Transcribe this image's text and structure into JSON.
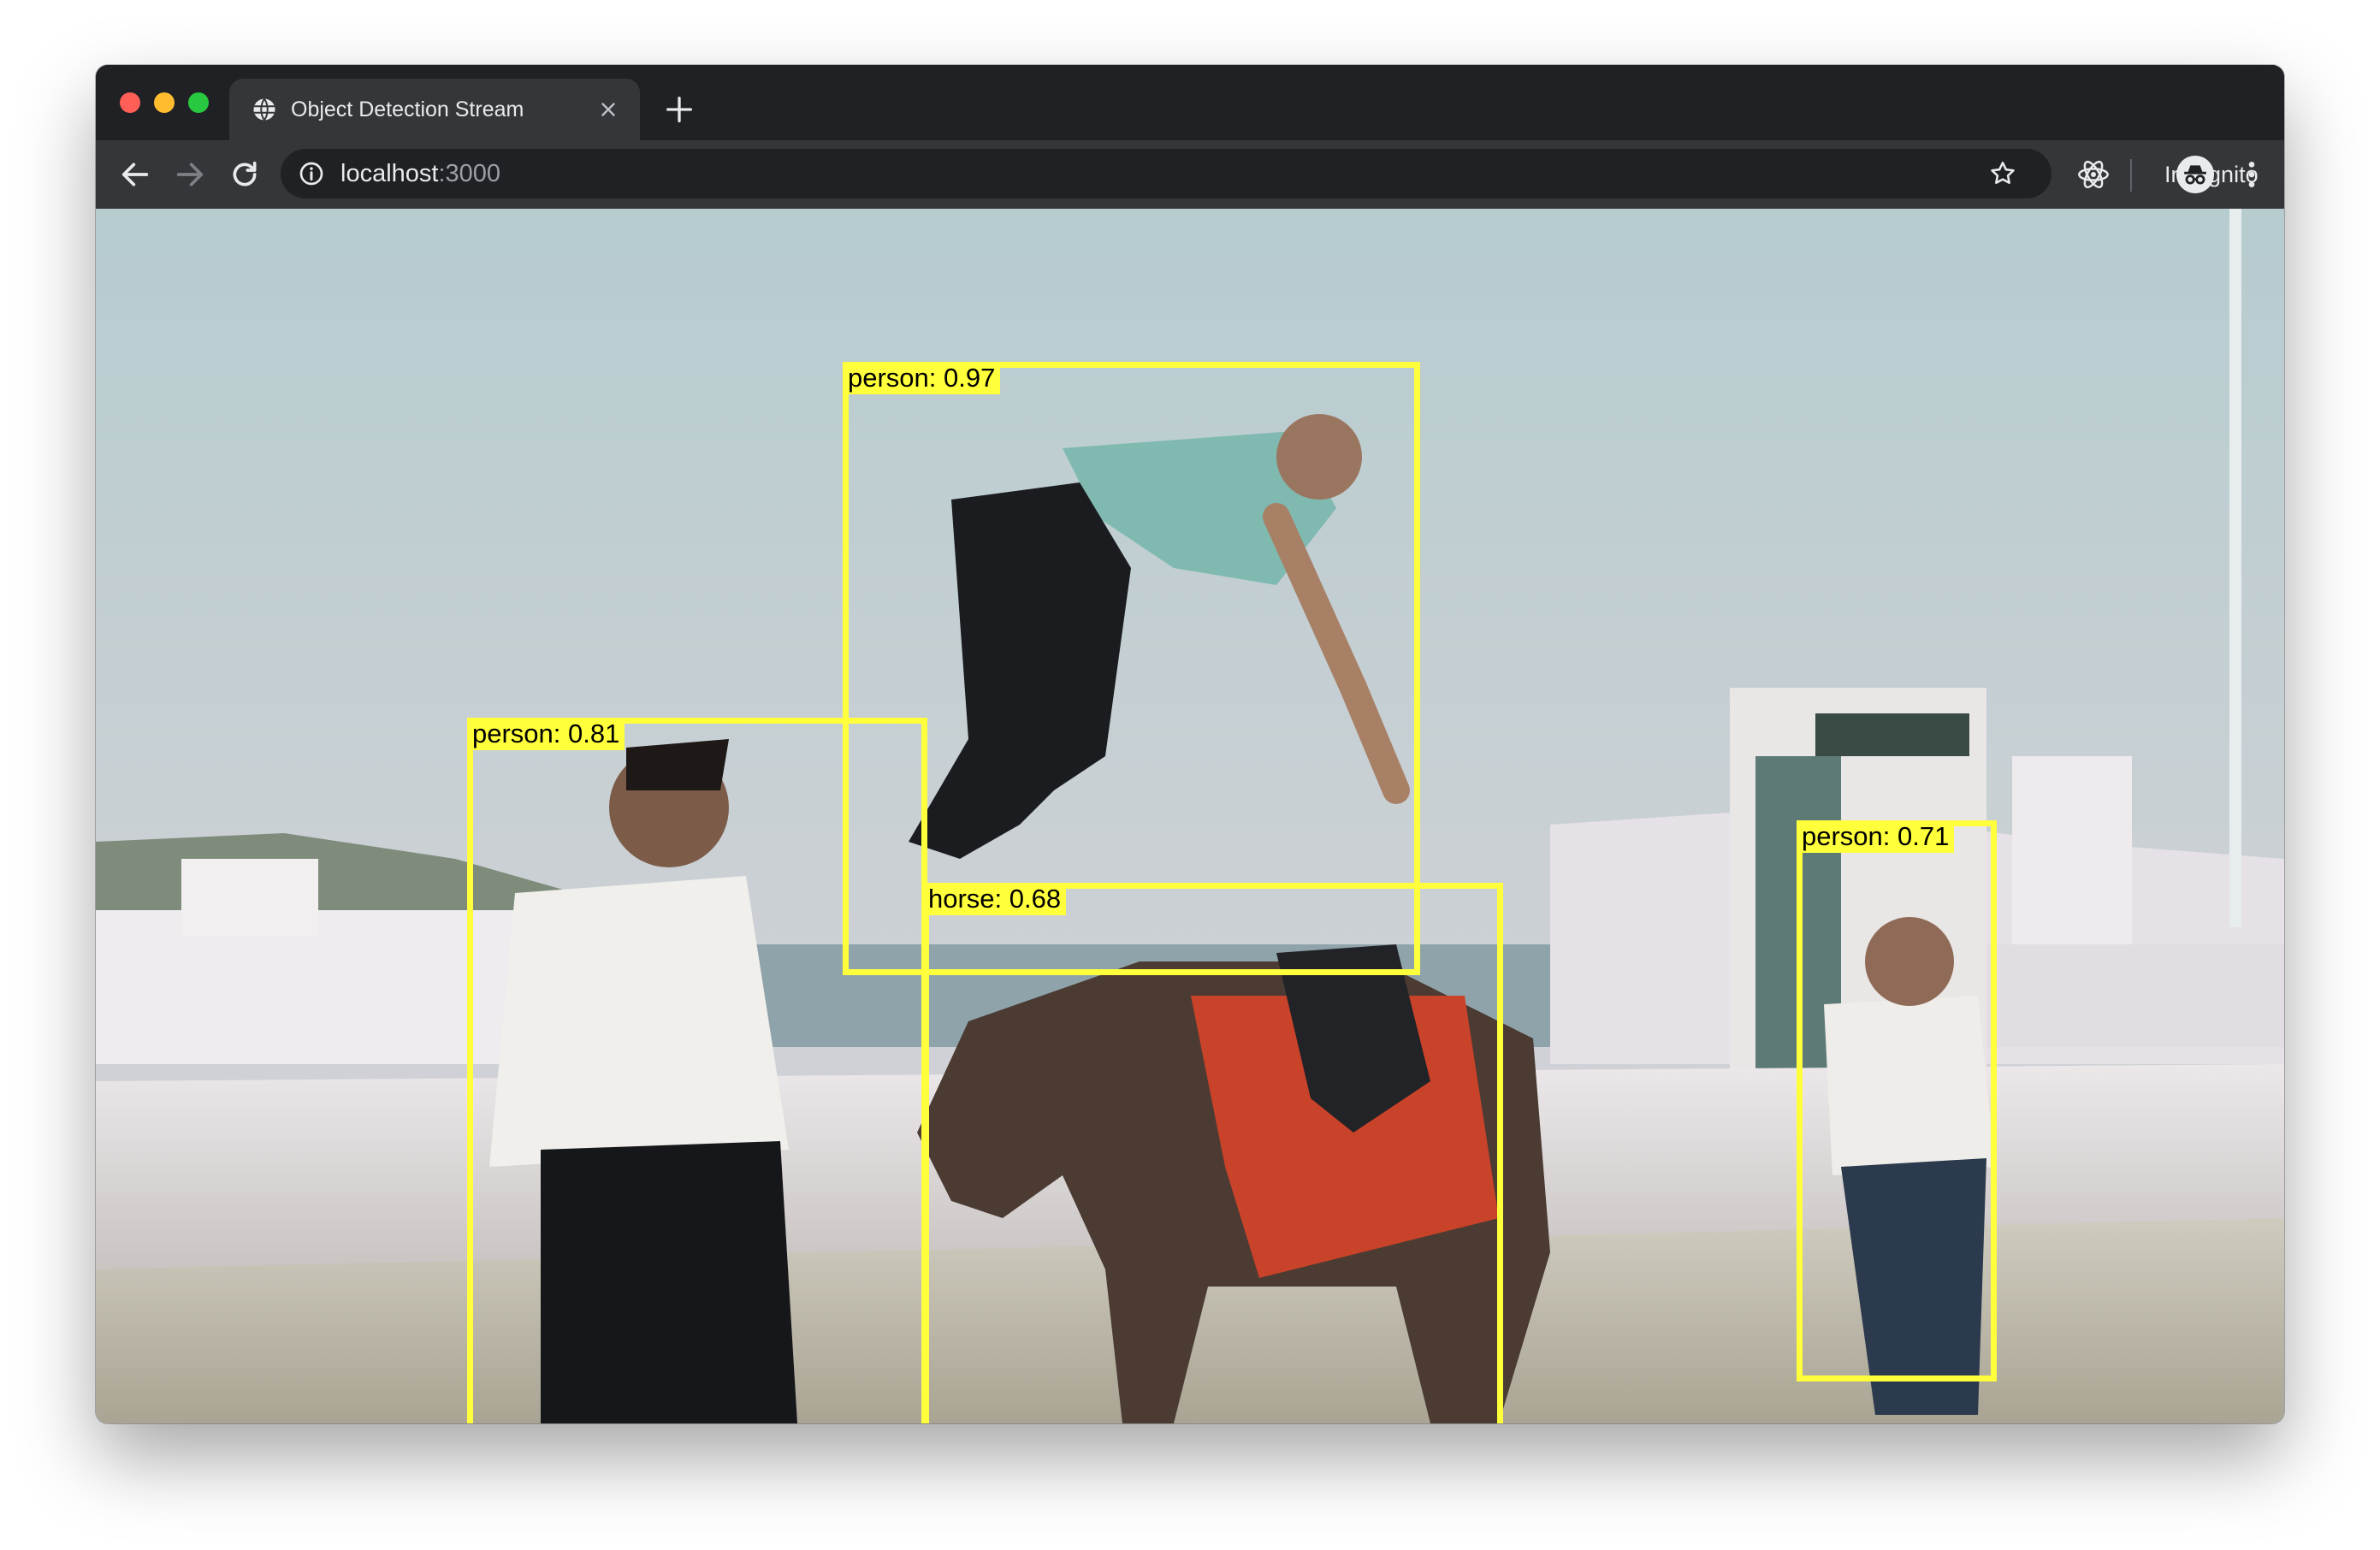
{
  "browser": {
    "tab_title": "Object Detection Stream",
    "url_host": "localhost",
    "url_port": ":3000",
    "profile_label": "Incognito"
  },
  "icons": {
    "tab_favicon": "globe-icon",
    "tab_close": "close-icon",
    "new_tab": "plus-icon",
    "back": "arrow-left-icon",
    "forward": "arrow-right-icon",
    "reload": "reload-icon",
    "site_info": "info-icon",
    "bookmark": "star-icon",
    "extension": "react-icon",
    "incognito": "incognito-icon",
    "menu": "kebab-menu-icon"
  },
  "colors": {
    "detection_box": "#ffff3c",
    "chrome_dark": "#202124",
    "chrome_toolbar": "#35363a"
  },
  "detections": [
    {
      "label": "person: 0.97"
    },
    {
      "label": "person: 0.81"
    },
    {
      "label": "horse: 0.68"
    },
    {
      "label": "person: 0.71"
    }
  ]
}
